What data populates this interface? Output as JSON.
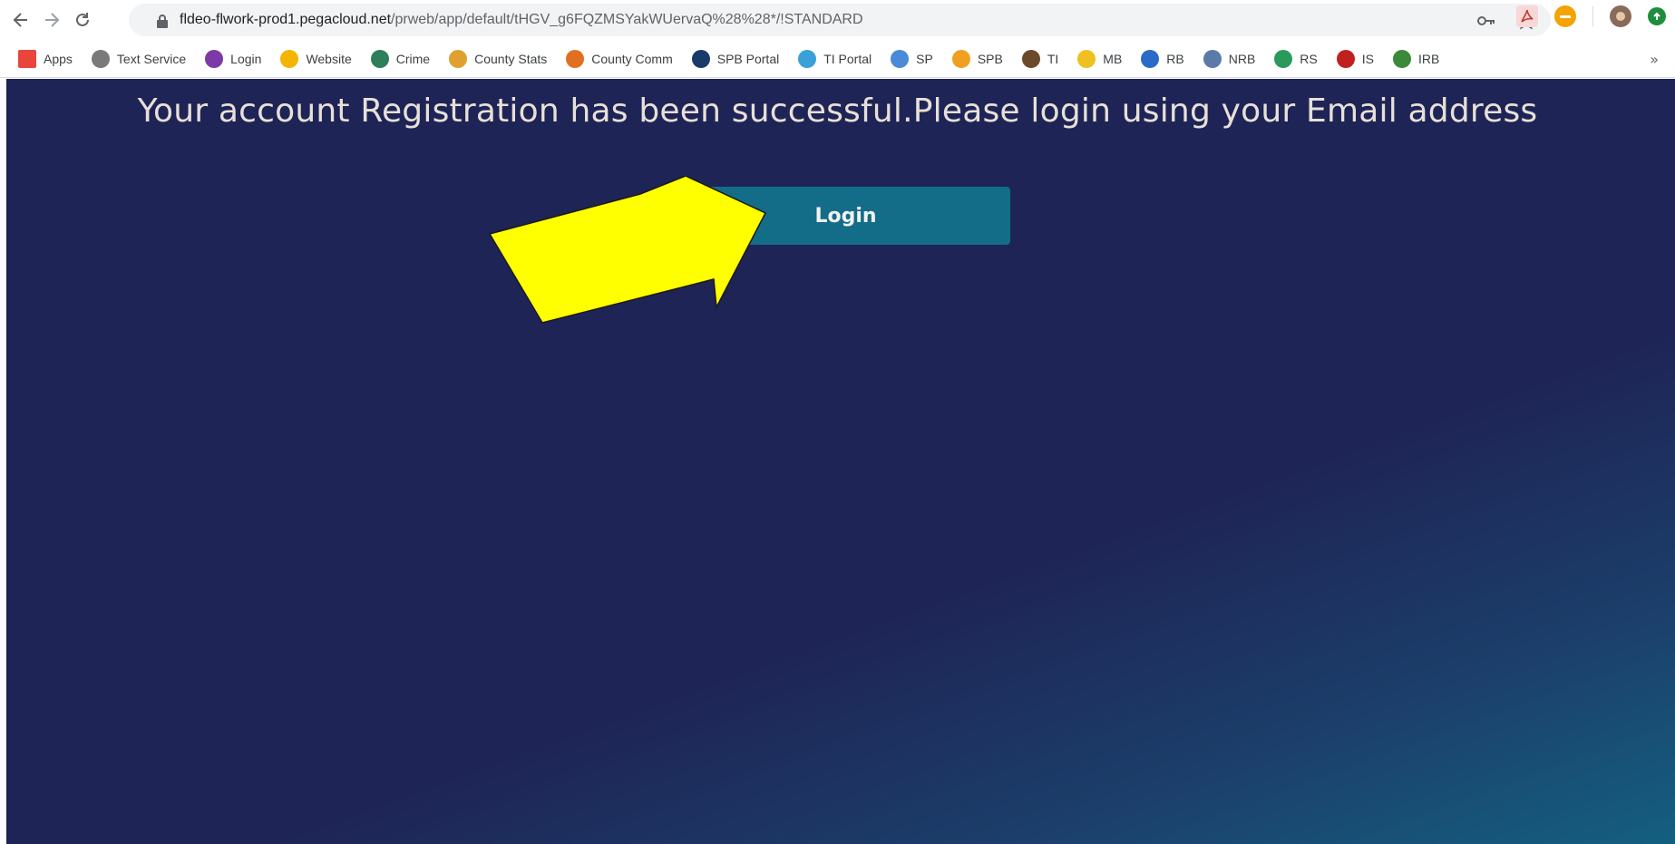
{
  "browser": {
    "url_host": "fldeo-flwork-prod1.pegacloud.net",
    "url_path": "/prweb/app/default/tHGV_g6FQZMSYakWUervaQ%28%28*/!STANDARD",
    "bookmarks": [
      {
        "label": "Apps",
        "icon": "apps-grid-icon",
        "color": "#e8453c"
      },
      {
        "label": "Text Service",
        "icon": "text-service-icon",
        "color": "#7a7a7a"
      },
      {
        "label": "Login",
        "icon": "login-icon",
        "color": "#7b3aa5"
      },
      {
        "label": "Website",
        "icon": "website-icon",
        "color": "#f4b400"
      },
      {
        "label": "Crime",
        "icon": "crime-icon",
        "color": "#2e7d5b"
      },
      {
        "label": "County Stats",
        "icon": "county-stats-icon",
        "color": "#e0a030"
      },
      {
        "label": "County Comm",
        "icon": "county-comm-icon",
        "color": "#e07020"
      },
      {
        "label": "SPB Portal",
        "icon": "spb-portal-icon",
        "color": "#1a3a6a"
      },
      {
        "label": "TI Portal",
        "icon": "ti-portal-icon",
        "color": "#3aa0d8"
      },
      {
        "label": "SP",
        "icon": "sp-icon",
        "color": "#4a8ad8"
      },
      {
        "label": "SPB",
        "icon": "spb-icon",
        "color": "#f0a020"
      },
      {
        "label": "TI",
        "icon": "ti-icon",
        "color": "#6a4a2a"
      },
      {
        "label": "MB",
        "icon": "mb-icon",
        "color": "#f0c020"
      },
      {
        "label": "RB",
        "icon": "rb-icon",
        "color": "#2a6ac8"
      },
      {
        "label": "NRB",
        "icon": "nrb-icon",
        "color": "#5a7aa8"
      },
      {
        "label": "RS",
        "icon": "rs-icon",
        "color": "#2a9a5a"
      },
      {
        "label": "IS",
        "icon": "is-icon",
        "color": "#c02020"
      },
      {
        "label": "IRB",
        "icon": "irb-icon",
        "color": "#3a8a3a"
      }
    ],
    "more": "»"
  },
  "page": {
    "message": "Your account Registration has been successful.Please login using your Email address",
    "login_button": "Login",
    "background": "#1e2455",
    "button_color": "#136c88",
    "arrow_color": "#ffff00"
  }
}
